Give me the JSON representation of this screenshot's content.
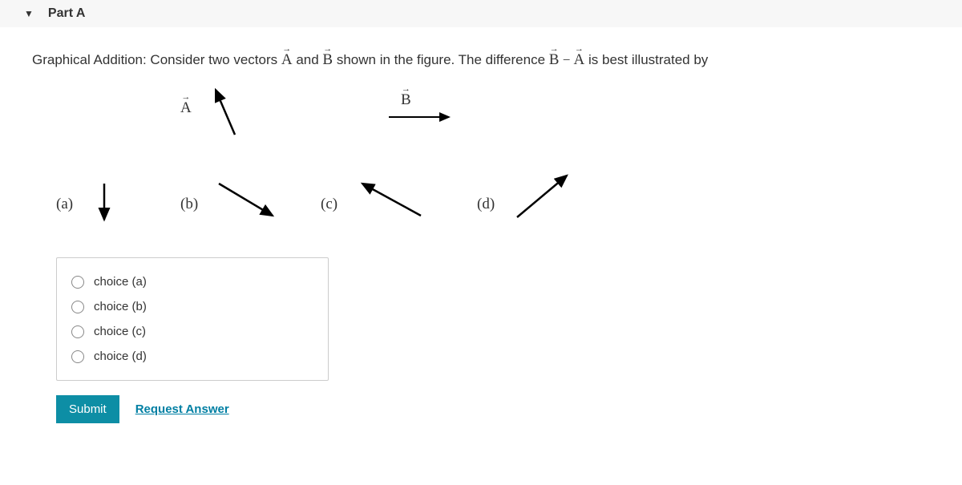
{
  "header": {
    "title": "Part A"
  },
  "prompt": {
    "pre": "Graphical Addition: Consider two vectors ",
    "vecA": "A",
    "mid1": " and ",
    "vecB": "B",
    "mid2": " shown in the figure. The difference ",
    "diffB": "B",
    "minus": " − ",
    "diffA": "A",
    "post": " is best illustrated by"
  },
  "figure": {
    "labelA": "A",
    "labelB": "B",
    "options": {
      "a": "(a)",
      "b": "(b)",
      "c": "(c)",
      "d": "(d)"
    }
  },
  "choices": [
    {
      "label": "choice (a)"
    },
    {
      "label": "choice (b)"
    },
    {
      "label": "choice (c)"
    },
    {
      "label": "choice (d)"
    }
  ],
  "actions": {
    "submit": "Submit",
    "request": "Request Answer"
  }
}
